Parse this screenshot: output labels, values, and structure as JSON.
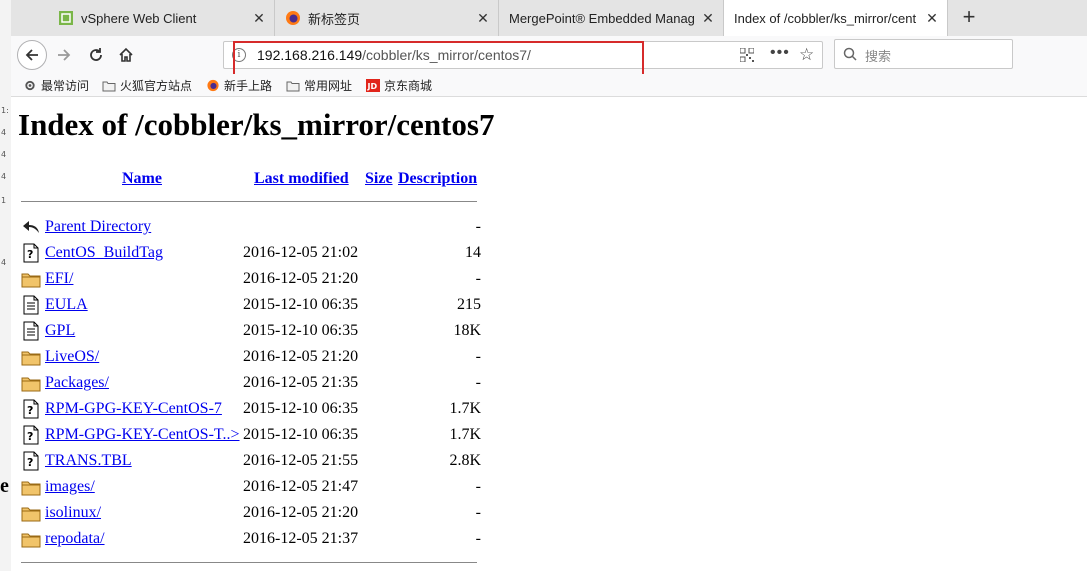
{
  "tabs": [
    {
      "title": "vSphere Web Client",
      "active": false
    },
    {
      "title": "新标签页",
      "active": false
    },
    {
      "title": "MergePoint® Embedded Manag",
      "active": false
    },
    {
      "title": "Index of /cobbler/ks_mirror/cent",
      "active": true
    }
  ],
  "url": {
    "host": "192.168.216.149",
    "path": "/cobbler/ks_mirror/centos7/"
  },
  "search_placeholder": "搜索",
  "bookmarks": [
    "最常访问",
    "火狐官方站点",
    "新手上路",
    "常用网址",
    "京东商城"
  ],
  "page": {
    "title": "Index of /cobbler/ks_mirror/centos7",
    "columns": {
      "name": "Name",
      "modified": "Last modified",
      "size": "Size",
      "description": "Description"
    },
    "rows": [
      {
        "name": "Parent Directory",
        "date": "",
        "size": "-",
        "icon": "back-icon"
      },
      {
        "name": "CentOS_BuildTag",
        "date": "2016-12-05 21:02",
        "size": "14",
        "icon": "unknown-file-icon"
      },
      {
        "name": "EFI/",
        "date": "2016-12-05 21:20",
        "size": "-",
        "icon": "folder-icon"
      },
      {
        "name": "EULA",
        "date": "2015-12-10 06:35",
        "size": "215",
        "icon": "text-file-icon"
      },
      {
        "name": "GPL",
        "date": "2015-12-10 06:35",
        "size": "18K",
        "icon": "text-file-icon"
      },
      {
        "name": "LiveOS/",
        "date": "2016-12-05 21:20",
        "size": "-",
        "icon": "folder-icon"
      },
      {
        "name": "Packages/",
        "date": "2016-12-05 21:35",
        "size": "-",
        "icon": "folder-icon"
      },
      {
        "name": "RPM-GPG-KEY-CentOS-7",
        "date": "2015-12-10 06:35",
        "size": "1.7K",
        "icon": "unknown-file-icon"
      },
      {
        "name": "RPM-GPG-KEY-CentOS-T..>",
        "date": "2015-12-10 06:35",
        "size": "1.7K",
        "icon": "unknown-file-icon"
      },
      {
        "name": "TRANS.TBL",
        "date": "2016-12-05 21:55",
        "size": "2.8K",
        "icon": "unknown-file-icon"
      },
      {
        "name": "images/",
        "date": "2016-12-05 21:47",
        "size": "-",
        "icon": "folder-icon"
      },
      {
        "name": "isolinux/",
        "date": "2016-12-05 21:20",
        "size": "-",
        "icon": "folder-icon"
      },
      {
        "name": "repodata/",
        "date": "2016-12-05 21:37",
        "size": "-",
        "icon": "folder-icon"
      }
    ]
  },
  "colors": {
    "link": "#0000ee",
    "highlight_box": "#d62b2b",
    "tab_bar": "#e4e4e4"
  }
}
